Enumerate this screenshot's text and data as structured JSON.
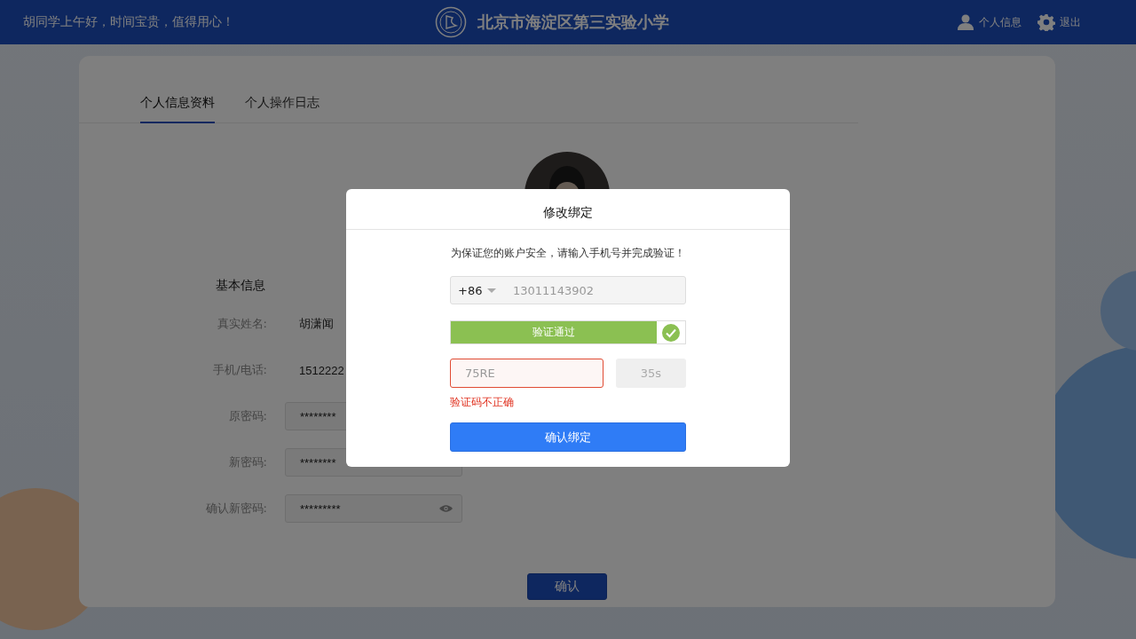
{
  "header": {
    "greeting": "胡同学上午好，时间宝贵，值得用心！",
    "school_name": "北京市海淀区第三实验小学",
    "links": [
      {
        "kind": "user",
        "label": "个人信息"
      },
      {
        "kind": "settings",
        "label": "退出"
      }
    ]
  },
  "tabs": [
    {
      "label": "个人信息资料",
      "selected": true
    },
    {
      "label": "个人操作日志",
      "selected": false
    }
  ],
  "basic_info": {
    "title": "基本信息",
    "fields": [
      {
        "kind": "text",
        "label": "真实姓名:",
        "value": "胡潇闻"
      },
      {
        "kind": "text",
        "label": "手机/电话:",
        "value": "1512222"
      },
      {
        "kind": "password",
        "label": "原密码:",
        "value": "********",
        "eye": false
      },
      {
        "kind": "password",
        "label": "新密码:",
        "value": "********",
        "eye": false
      },
      {
        "kind": "password",
        "label": "确认新密码:",
        "value": "*********",
        "eye": true
      }
    ]
  },
  "confirm_button": "确认",
  "dialog": {
    "title": "修改绑定",
    "message": "为保证您的账户安全，请输入手机号并完成验证！",
    "country_code": "+86",
    "phone": "13011143902",
    "slider": {
      "label": "验证通过",
      "level": 1,
      "verified": true
    },
    "code_input": {
      "value": "75RE",
      "error": true
    },
    "countdown": {
      "label": "35s",
      "disabled": true
    },
    "error_message": "验证码不正确",
    "submit": "确认绑定"
  }
}
